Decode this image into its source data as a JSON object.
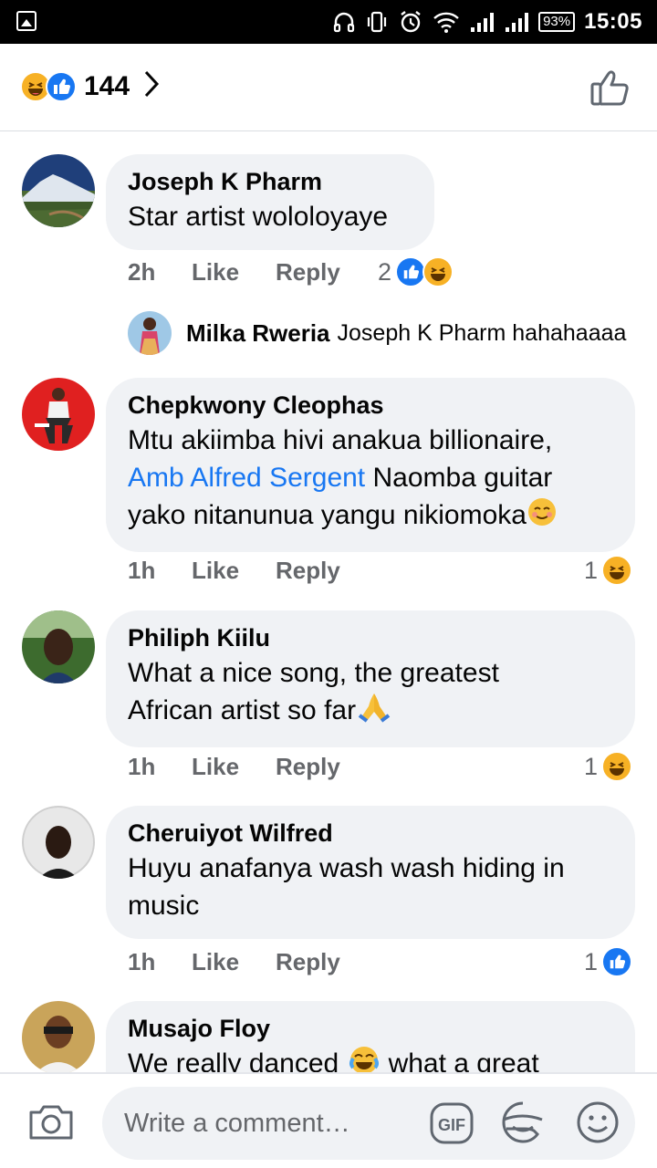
{
  "status_bar": {
    "battery": "93%",
    "time": "15:05"
  },
  "header": {
    "reaction_count": "144",
    "reaction_icons": [
      "haha-icon",
      "like-icon"
    ]
  },
  "comments": [
    {
      "author": "Joseph K Pharm",
      "text": "Star artist wololoyaye",
      "time": "2h",
      "like_label": "Like",
      "reply_label": "Reply",
      "reaction_count": "2",
      "reactions": [
        "like",
        "haha"
      ],
      "reply": {
        "author": "Milka Rweria",
        "text": "Joseph K Pharm hahahaaaa"
      }
    },
    {
      "author": "Chepkwony Cleophas",
      "text_line1": "Mtu akiimba hivi anakua billionaire,",
      "mention": "Amb Alfred Sergent",
      "text_line2": " Naomba guitar",
      "text_line3": "yako nitanunua yangu nikiomoka",
      "time": "1h",
      "like_label": "Like",
      "reply_label": "Reply",
      "reaction_count": "1",
      "reactions": [
        "haha"
      ]
    },
    {
      "author": "Philiph Kiilu",
      "text_line1": "What a nice song, the greatest",
      "text_line2": "African artist so far",
      "time": "1h",
      "like_label": "Like",
      "reply_label": "Reply",
      "reaction_count": "1",
      "reactions": [
        "haha"
      ]
    },
    {
      "author": "Cheruiyot Wilfred",
      "text_line1": "Huyu anafanya wash wash hiding in",
      "text_line2": "music",
      "time": "1h",
      "like_label": "Like",
      "reply_label": "Reply",
      "reaction_count": "1",
      "reactions": [
        "like"
      ]
    },
    {
      "author": "Musajo Floy",
      "text_part1": "We really danced",
      "text_part2": " what a great"
    }
  ],
  "composer": {
    "placeholder": "Write a comment…"
  },
  "colors": {
    "accent": "#1877f2",
    "bubble": "#f0f2f5",
    "muted_text": "#65676b",
    "haha": "#f7b125"
  }
}
